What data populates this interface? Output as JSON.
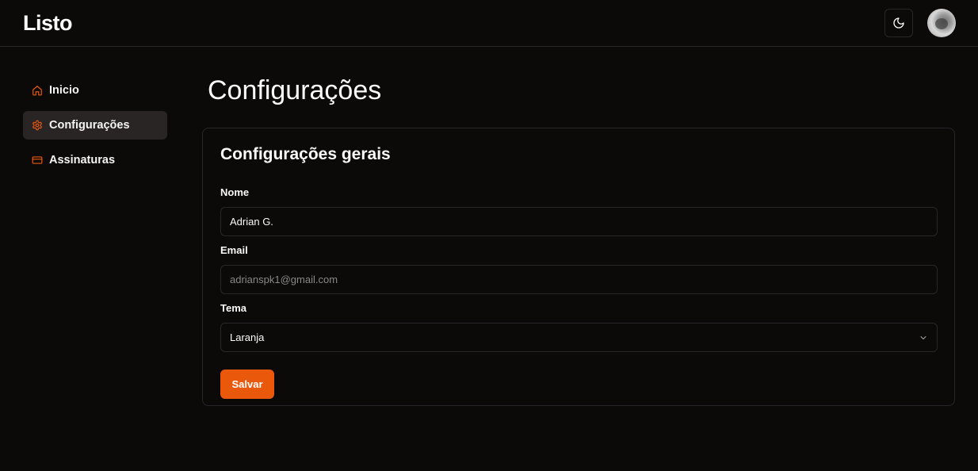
{
  "app": {
    "brand": "Listo"
  },
  "header": {
    "theme_toggle_icon": "moon-icon",
    "avatar_icon": "user-avatar"
  },
  "sidebar": {
    "items": [
      {
        "label": "Inicio",
        "icon": "home-icon",
        "active": false
      },
      {
        "label": "Configurações",
        "icon": "gear-icon",
        "active": true
      },
      {
        "label": "Assinaturas",
        "icon": "credit-card-icon",
        "active": false
      }
    ]
  },
  "page": {
    "title": "Configurações"
  },
  "settings_card": {
    "title": "Configurações gerais",
    "name_label": "Nome",
    "name_value": "Adrian G.",
    "email_label": "Email",
    "email_value": "adrianspk1@gmail.com",
    "theme_label": "Tema",
    "theme_value": "Laranja",
    "save_label": "Salvar"
  },
  "colors": {
    "accent": "#ea580c",
    "background": "#0c0a09",
    "border": "#27272a",
    "active_nav": "#292524"
  }
}
